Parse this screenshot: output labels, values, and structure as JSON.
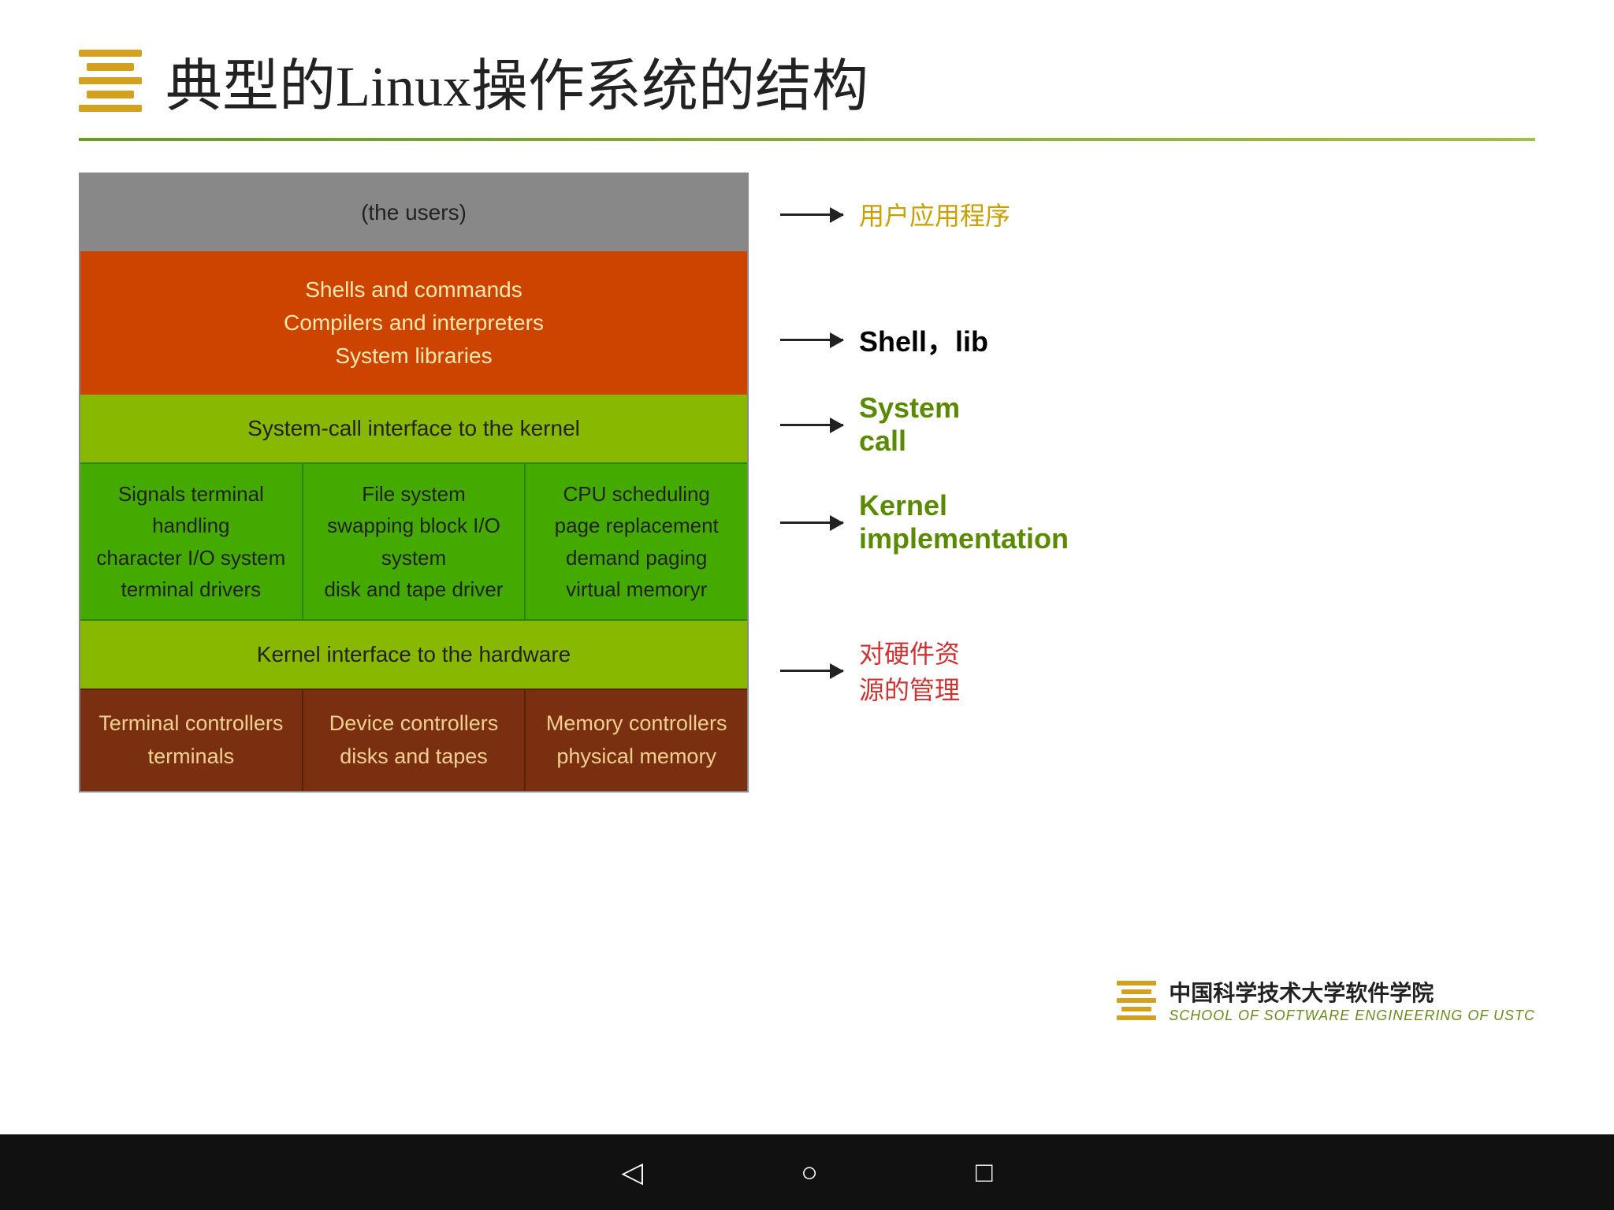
{
  "slide": {
    "title": "典型的Linux操作系统的结构",
    "divider": true
  },
  "diagram": {
    "users_layer": "(the users)",
    "orange_layer": {
      "line1": "Shells and commands",
      "line2": "Compilers and interpreters",
      "line3": "System libraries"
    },
    "syscall_layer": "System-call interface to the kernel",
    "kernel_cols": [
      {
        "lines": [
          "Signals terminal",
          "handling",
          "character I/O system",
          "terminal    drivers"
        ]
      },
      {
        "lines": [
          "File system",
          "swapping block I/O",
          "system",
          "disk and tape driver"
        ]
      },
      {
        "lines": [
          "CPU scheduling",
          "page replacement",
          "demand paging",
          "virtual memoryr"
        ]
      }
    ],
    "hw_interface_layer": "Kernel interface to the hardware",
    "hardware_cols": [
      {
        "lines": [
          "Terminal controllers",
          "terminals"
        ]
      },
      {
        "lines": [
          "Device controllers",
          "disks and tapes"
        ]
      },
      {
        "lines": [
          "Memory controllers",
          "physical memory"
        ]
      }
    ]
  },
  "annotations": {
    "users": "用户应用程序",
    "shell_label": "Shell，lib",
    "syscall_label1": "System",
    "syscall_label2": "call",
    "kernel_label1": "Kernel",
    "kernel_label2": "implementation",
    "hw_label1": "对硬件资",
    "hw_label2": "源的管理"
  },
  "footer": {
    "school_name": "中国科学技术大学软件学院",
    "school_name_en": "SCHOOL OF SOFTWARE ENGINEERING OF USTC"
  },
  "navbar": {
    "back": "◁",
    "home": "○",
    "recent": "□"
  }
}
